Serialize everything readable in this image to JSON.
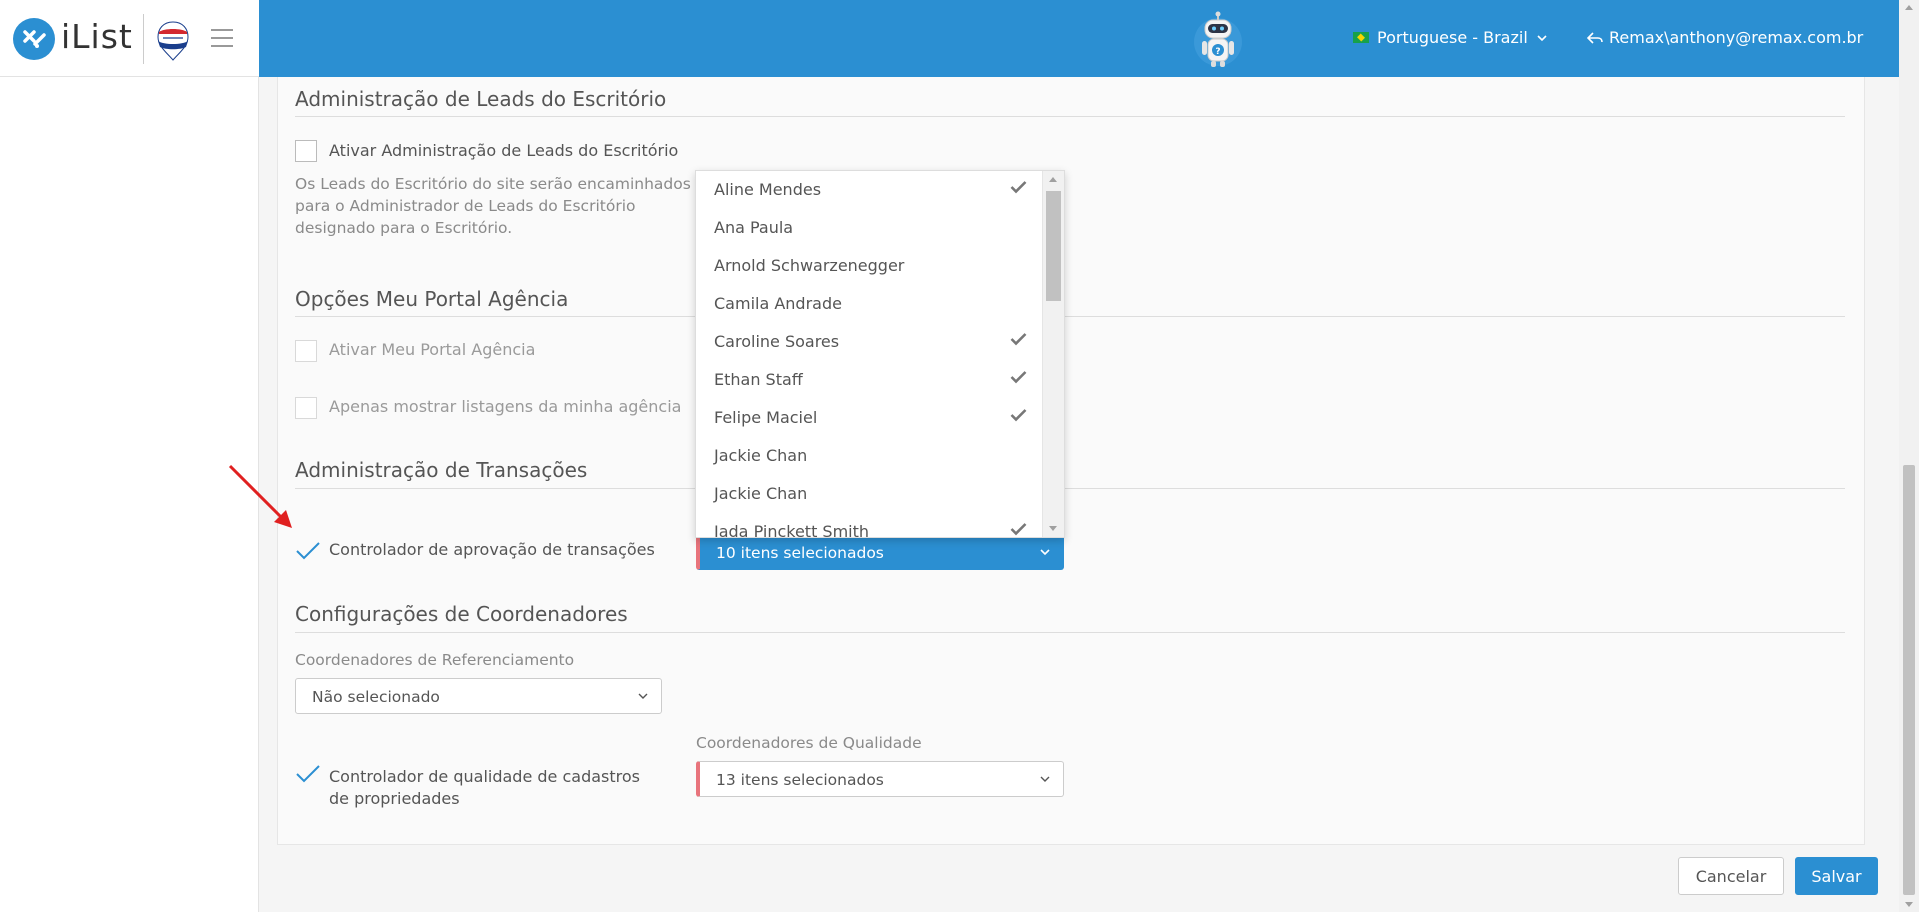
{
  "header": {
    "app_name": "iList",
    "language": "Portuguese - Brazil",
    "user": "Remax\\anthony@remax.com.br",
    "brand_color": "#2b8fd2"
  },
  "sections": {
    "leads": {
      "title": "Administração de Leads do Escritório",
      "checkbox_label": "Ativar Administração de Leads do Escritório",
      "checked": false,
      "description": "Os Leads do Escritório do site serão encaminhados para o Administrador de Leads do Escritório designado para o Escritório."
    },
    "portal": {
      "title": "Opções Meu Portal Agência",
      "option1": "Ativar Meu Portal Agência",
      "option2": "Apenas mostrar listagens da minha agência"
    },
    "transactions": {
      "title": "Administração de Transações",
      "checkbox_label": "Controlador de aprovação de transações",
      "checked": true,
      "select_value": "10 itens selecionados"
    },
    "coordinators": {
      "title": "Configurações de Coordenadores",
      "referral_label": "Coordenadores de Referenciamento",
      "referral_value": "Não selecionado",
      "quality_checkbox_line1": "Controlador de qualidade de cadastros",
      "quality_checkbox_line2": "de propriedades",
      "quality_checked": true,
      "quality_label": "Coordenadores de Qualidade",
      "quality_value": "13 itens selecionados"
    }
  },
  "dropdown": {
    "items": [
      {
        "name": "Aline Mendes",
        "selected": true
      },
      {
        "name": "Ana Paula",
        "selected": false
      },
      {
        "name": "Arnold Schwarzenegger",
        "selected": false
      },
      {
        "name": "Camila Andrade",
        "selected": false
      },
      {
        "name": "Caroline Soares",
        "selected": true
      },
      {
        "name": "Ethan Staff",
        "selected": true
      },
      {
        "name": "Felipe Maciel",
        "selected": true
      },
      {
        "name": "Jackie Chan",
        "selected": false
      },
      {
        "name": "Jackie Chan",
        "selected": false
      },
      {
        "name": "Jada Pinckett Smith",
        "selected": true
      }
    ]
  },
  "buttons": {
    "cancel": "Cancelar",
    "save": "Salvar"
  },
  "colors": {
    "accent": "#2b8fd2",
    "required_marker": "#e8747c",
    "annotation_arrow": "#e02020"
  }
}
